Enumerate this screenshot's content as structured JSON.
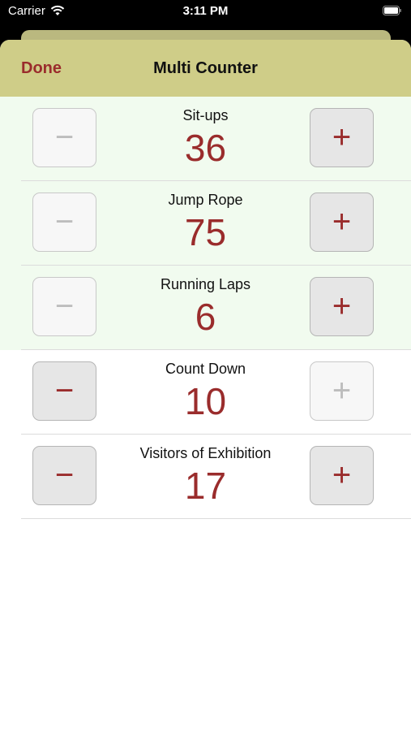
{
  "status_bar": {
    "carrier": "Carrier",
    "time": "3:11 PM"
  },
  "navbar": {
    "done_label": "Done",
    "title": "Multi Counter"
  },
  "counters": [
    {
      "label": "Sit-ups",
      "value": "36",
      "minus": "−",
      "plus": "+",
      "minus_enabled": false,
      "plus_enabled": true
    },
    {
      "label": "Jump Rope",
      "value": "75",
      "minus": "−",
      "plus": "+",
      "minus_enabled": false,
      "plus_enabled": true
    },
    {
      "label": "Running Laps",
      "value": "6",
      "minus": "−",
      "plus": "+",
      "minus_enabled": false,
      "plus_enabled": true
    },
    {
      "label": "Count Down",
      "value": "10",
      "minus": "−",
      "plus": "+",
      "minus_enabled": true,
      "plus_enabled": false
    },
    {
      "label": "Visitors of Exhibition",
      "value": "17",
      "minus": "−",
      "plus": "+",
      "minus_enabled": true,
      "plus_enabled": true
    }
  ],
  "colors": {
    "navbar": "#cfcd88",
    "accent": "#9a2c2c",
    "highlight_row": "#f1fbef"
  }
}
